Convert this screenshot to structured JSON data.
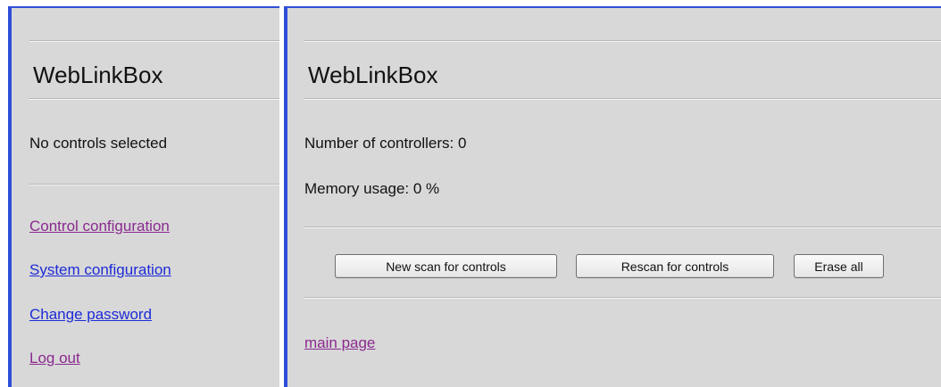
{
  "sidebar": {
    "title": "WebLinkBox",
    "status": "No controls selected",
    "links": [
      {
        "label": "Control configuration",
        "state": "visited"
      },
      {
        "label": "System configuration",
        "state": "unvisited"
      },
      {
        "label": "Change password",
        "state": "unvisited"
      },
      {
        "label": "Log out",
        "state": "visited"
      }
    ]
  },
  "main": {
    "title": "WebLinkBox",
    "controllers_text": "Number of controllers: 0",
    "memory_text": "Memory usage: 0 %",
    "buttons": {
      "new_scan": "New scan for controls",
      "rescan": "Rescan for controls",
      "erase": "Erase all"
    },
    "main_page_link": "main page"
  },
  "colors": {
    "frame_border": "#2f4ed8",
    "background": "#d8d8d8",
    "link_visited": "#8a2a8f",
    "link_unvisited": "#1d2bd6"
  }
}
